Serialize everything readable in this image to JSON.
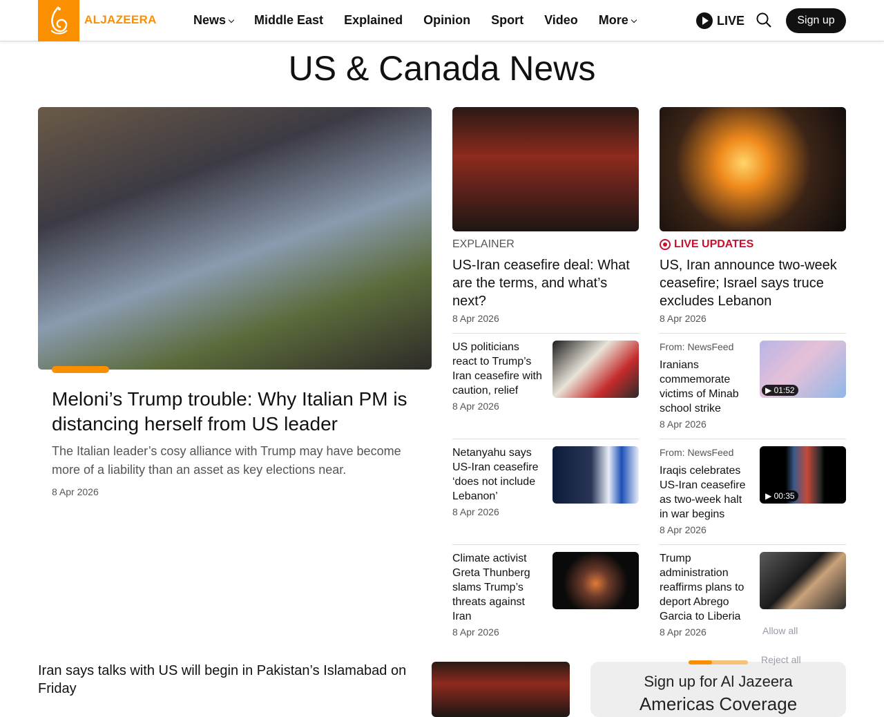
{
  "header": {
    "logo_text": "ALJAZEERA",
    "nav": [
      {
        "label": "News",
        "dropdown": true
      },
      {
        "label": "Middle East"
      },
      {
        "label": "Explained"
      },
      {
        "label": "Opinion"
      },
      {
        "label": "Sport"
      },
      {
        "label": "Video"
      },
      {
        "label": "More",
        "dropdown": true
      }
    ],
    "live_label": "LIVE",
    "signup_label": "Sign up"
  },
  "page": {
    "title": "US & Canada News"
  },
  "hero": {
    "title": "Meloni’s Trump trouble: Why Italian PM is distancing herself from US leader",
    "subtitle": "The Italian leader’s cosy alliance with Trump may have become more of a liability than an asset as key elections near.",
    "date": "8 Apr 2026"
  },
  "cards": [
    {
      "kicker": "EXPLAINER",
      "title": "US-Iran ceasefire deal: What are the terms, and what’s next?",
      "date": "8 Apr 2026"
    },
    {
      "kicker": "LIVE UPDATES",
      "title": "US, Iran announce two-week ceasefire; Israel says truce excludes Lebanon",
      "date": "8 Apr 2026"
    }
  ],
  "left_list": [
    {
      "title": "US politicians react to Trump’s Iran ceasefire with caution, relief",
      "date": "8 Apr 2026"
    },
    {
      "title": "Netanyahu says US-Iran ceasefire ‘does not include Lebanon’",
      "date": "8 Apr 2026"
    },
    {
      "title": "Climate activist Greta Thunberg slams Trump’s threats against Iran",
      "date": "8 Apr 2026"
    }
  ],
  "right_list": [
    {
      "from": "From: NewsFeed",
      "title": "Iranians commemorate victims of Minab school strike",
      "date": "8 Apr 2026",
      "duration": "01:52"
    },
    {
      "from": "From: NewsFeed",
      "title": "Iraqis celebrates US-Iran ceasefire as two-week halt in war begins",
      "date": "8 Apr 2026",
      "duration": "00:35"
    },
    {
      "title": "Trump administration reaffirms plans to deport Abrego Garcia to Liberia",
      "date": "8 Apr 2026"
    }
  ],
  "bottom": {
    "title": "Iran says talks with US will begin in Pakistan’s Islamabad on Friday"
  },
  "signup_box": {
    "line1": "Sign up for Al Jazeera",
    "line2": "Americas Coverage"
  },
  "cookie": {
    "allow_label": "Allow all",
    "reject_label": "Reject all"
  },
  "colors": {
    "brand": "#fa9000",
    "live_red": "#c8102e"
  }
}
